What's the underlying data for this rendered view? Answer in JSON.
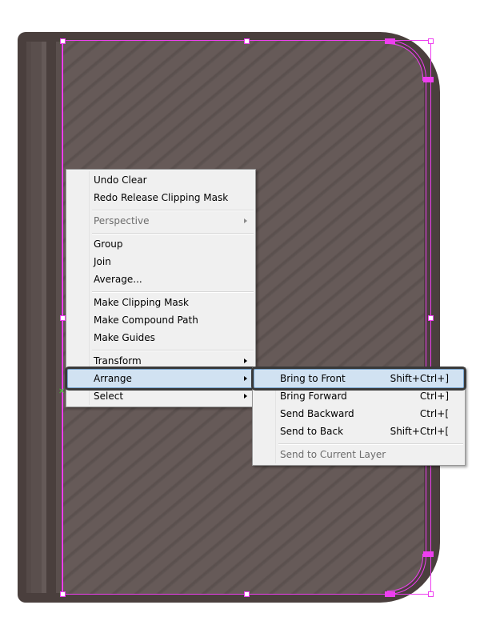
{
  "context_menu": {
    "items": [
      {
        "label": "Undo Clear",
        "enabled": true
      },
      {
        "label": "Redo Release Clipping Mask",
        "enabled": true
      },
      {
        "label": "Perspective",
        "enabled": false,
        "submenu": true
      },
      {
        "label": "Group",
        "enabled": true
      },
      {
        "label": "Join",
        "enabled": true
      },
      {
        "label": "Average...",
        "enabled": true
      },
      {
        "label": "Make Clipping Mask",
        "enabled": true
      },
      {
        "label": "Make Compound Path",
        "enabled": true
      },
      {
        "label": "Make Guides",
        "enabled": true
      },
      {
        "label": "Transform",
        "enabled": true,
        "submenu": true
      },
      {
        "label": "Arrange",
        "enabled": true,
        "submenu": true,
        "highlighted": true
      },
      {
        "label": "Select",
        "enabled": true,
        "submenu": true
      }
    ]
  },
  "arrange_submenu": {
    "items": [
      {
        "label": "Bring to Front",
        "shortcut": "Shift+Ctrl+]",
        "highlighted": true
      },
      {
        "label": "Bring Forward",
        "shortcut": "Ctrl+]"
      },
      {
        "label": "Send Backward",
        "shortcut": "Ctrl+["
      },
      {
        "label": "Send to Back",
        "shortcut": "Shift+Ctrl+["
      },
      {
        "label": "Send to Current Layer",
        "enabled": false
      }
    ]
  },
  "colors": {
    "selection": "#ee3ef0",
    "menu_highlight": "#d1e2f2",
    "book_cover": "#4a3f3d",
    "page": "#665a58"
  }
}
